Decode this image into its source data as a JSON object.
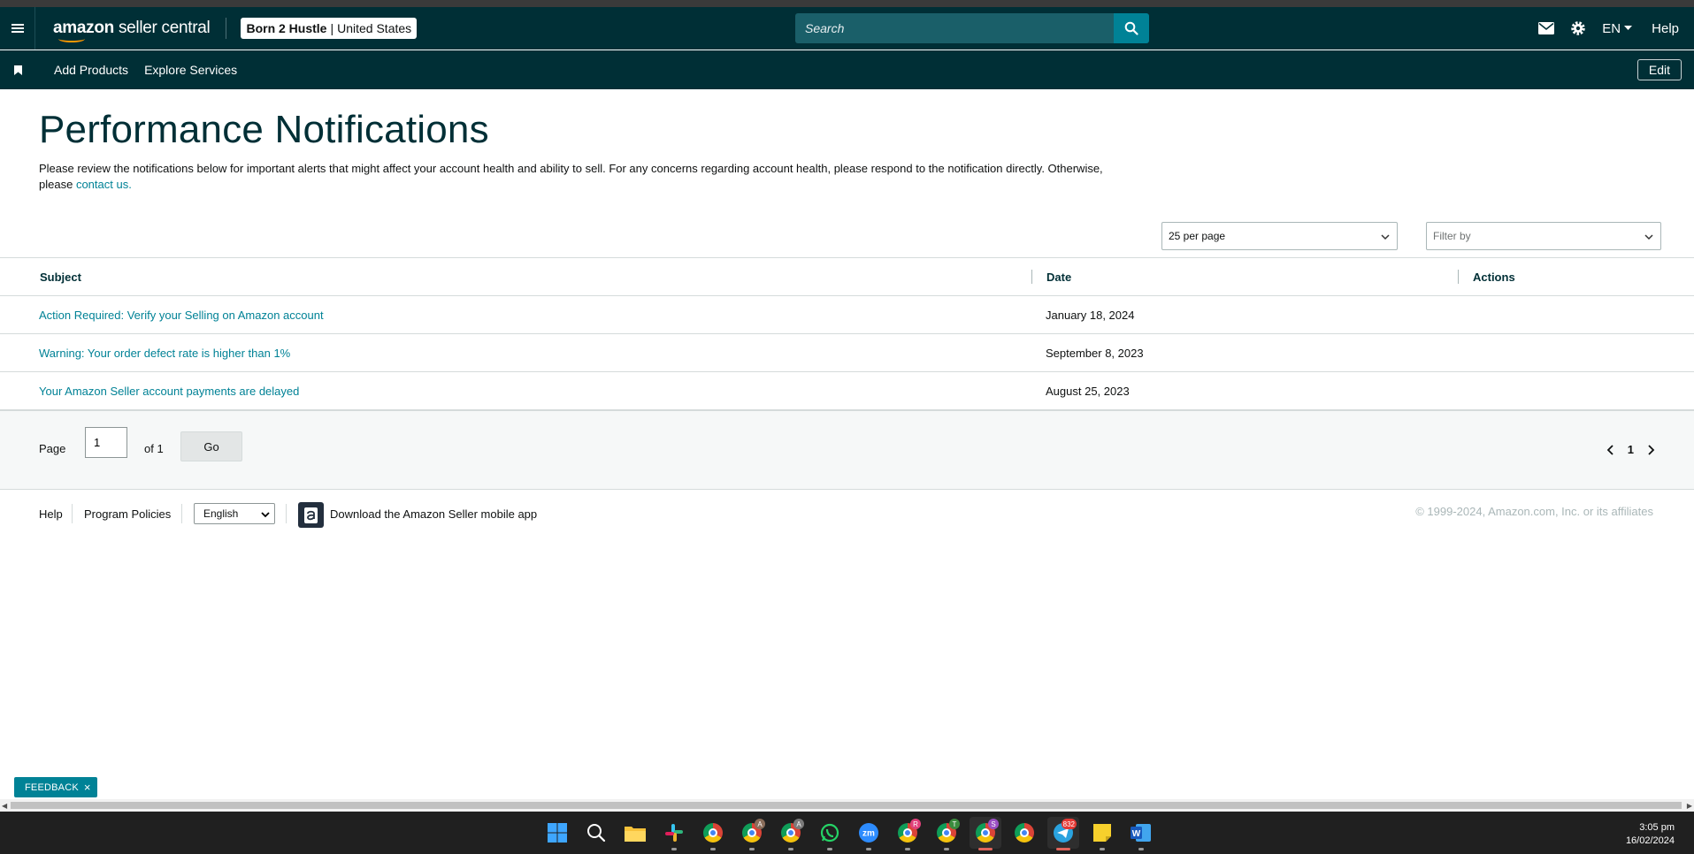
{
  "header": {
    "logo_text_bold": "amazon",
    "logo_text": "seller central",
    "account_store": "Born 2 Hustle",
    "account_marketplace": "United States",
    "search_placeholder": "Search",
    "language": "EN",
    "help_label": "Help"
  },
  "nav": {
    "items": [
      "Add Products",
      "Explore Services"
    ],
    "edit_label": "Edit"
  },
  "page": {
    "title": "Performance Notifications",
    "description": "Please review the notifications below for important alerts that might affect your account health and ability to sell. For any concerns regarding account health, please respond to the notification directly. Otherwise, please",
    "contact_link": "contact us."
  },
  "controls": {
    "per_page": "25 per page",
    "filter_placeholder": "Filter by"
  },
  "table": {
    "columns": [
      "Subject",
      "Date",
      "Actions"
    ],
    "rows": [
      {
        "subject": "Action Required: Verify your Selling on Amazon account",
        "date": "January 18, 2024"
      },
      {
        "subject": "Warning: Your order defect rate is higher than 1%",
        "date": "September 8, 2023"
      },
      {
        "subject": "Your Amazon Seller account payments are delayed",
        "date": "August 25, 2023"
      }
    ]
  },
  "pagination": {
    "page_label": "Page",
    "current_page": "1",
    "of_label": "of 1",
    "go_label": "Go",
    "page_number": "1"
  },
  "footer": {
    "help": "Help",
    "program_policies": "Program Policies",
    "language": "English",
    "app_text": "Download the Amazon Seller mobile app",
    "copyright": "© 1999-2024, Amazon.com, Inc. or its affiliates"
  },
  "feedback": {
    "label": "FEEDBACK",
    "close": "×"
  },
  "taskbar": {
    "time": "3:05 pm",
    "date": "16/02/2024",
    "telegram_badge": "832",
    "profile_badges": [
      "A",
      "A",
      "R",
      "T",
      "S"
    ]
  },
  "colors": {
    "header_bg": "#002f36",
    "accent": "#008296",
    "link": "#008296"
  }
}
